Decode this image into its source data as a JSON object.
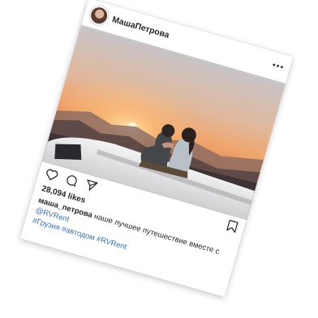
{
  "post": {
    "username": "МашаПетрова",
    "likes": "28,094 likes",
    "caption_user": "маша_петрова",
    "caption_text": " наше лучшее путешествие вместе с ",
    "mention": "@RVRent",
    "hashtags": "#Грузия #автодом #RVRent"
  },
  "icons": [
    "avatar",
    "more-icon",
    "heart-icon",
    "comment-icon",
    "share-icon",
    "bookmark-icon"
  ],
  "colors": {
    "link": "#3b6fa8",
    "text": "#262626"
  }
}
